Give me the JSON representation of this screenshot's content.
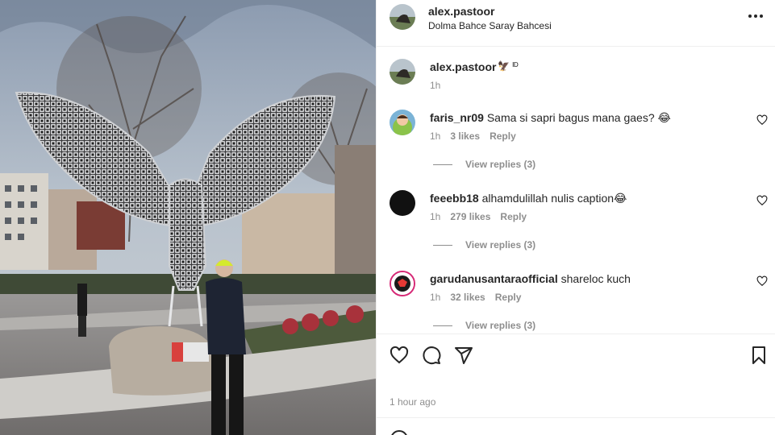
{
  "post": {
    "username": "alex.pastoor",
    "location": "Dolma Bahce Saray Bahcesi",
    "caption_text": "🦅 ᴵᴰ",
    "caption_time": "1h",
    "posted_ago": "1 hour ago"
  },
  "comments": [
    {
      "username": "faris_nr09",
      "text": "Sama si sapri bagus mana gaes? 😂",
      "time": "1h",
      "likes": "3 likes",
      "reply": "Reply",
      "view_replies": "View replies (3)",
      "avatar_color": "#7bb3d6"
    },
    {
      "username": "feeebb18",
      "text": "alhamdulillah nulis caption😂",
      "time": "1h",
      "likes": "279 likes",
      "reply": "Reply",
      "view_replies": "View replies (3)",
      "avatar_color": "#111111"
    },
    {
      "username": "garudanusantaraofficial",
      "text": "shareloc kuch",
      "time": "1h",
      "likes": "32 likes",
      "reply": "Reply",
      "view_replies": "View replies (3)",
      "avatar_color": "#1a1a1a"
    }
  ],
  "icons": {
    "more": "more-options-icon",
    "like": "heart-icon",
    "comment": "comment-icon",
    "share": "share-icon",
    "save": "bookmark-icon"
  },
  "colors": {
    "text": "#262626",
    "muted": "#8e8e8e",
    "border": "#efefef"
  }
}
